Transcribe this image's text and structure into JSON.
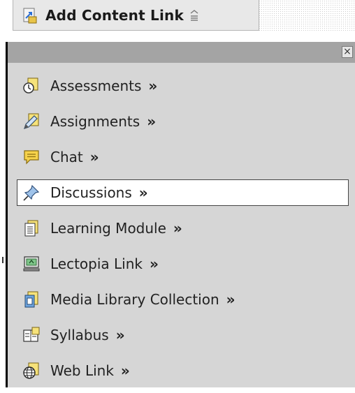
{
  "trigger": {
    "label": "Add Content Link",
    "icon": "add-link-icon",
    "caret_icon": "dropdown-caret-icon"
  },
  "menu": {
    "close_label": "×",
    "items": [
      {
        "label": "Assessments",
        "arrow": "»",
        "icon": "clock-icon",
        "active": false
      },
      {
        "label": "Assignments",
        "arrow": "»",
        "icon": "pencil-icon",
        "active": false
      },
      {
        "label": "Chat",
        "arrow": "»",
        "icon": "chat-bubble-icon",
        "active": false
      },
      {
        "label": "Discussions",
        "arrow": "»",
        "icon": "pushpin-icon",
        "active": true
      },
      {
        "label": "Learning Module",
        "arrow": "»",
        "icon": "document-stack-icon",
        "active": false
      },
      {
        "label": "Lectopia Link",
        "arrow": "»",
        "icon": "monitor-icon",
        "active": false
      },
      {
        "label": "Media Library Collection",
        "arrow": "»",
        "icon": "media-library-icon",
        "active": false
      },
      {
        "label": "Syllabus",
        "arrow": "»",
        "icon": "syllabus-icon",
        "active": false
      },
      {
        "label": "Web Link",
        "arrow": "»",
        "icon": "globe-icon",
        "active": false
      }
    ]
  },
  "colors": {
    "menu_bg": "#d6d6d6",
    "menu_header": "#a4a4a4",
    "active_bg": "#ffffff"
  }
}
